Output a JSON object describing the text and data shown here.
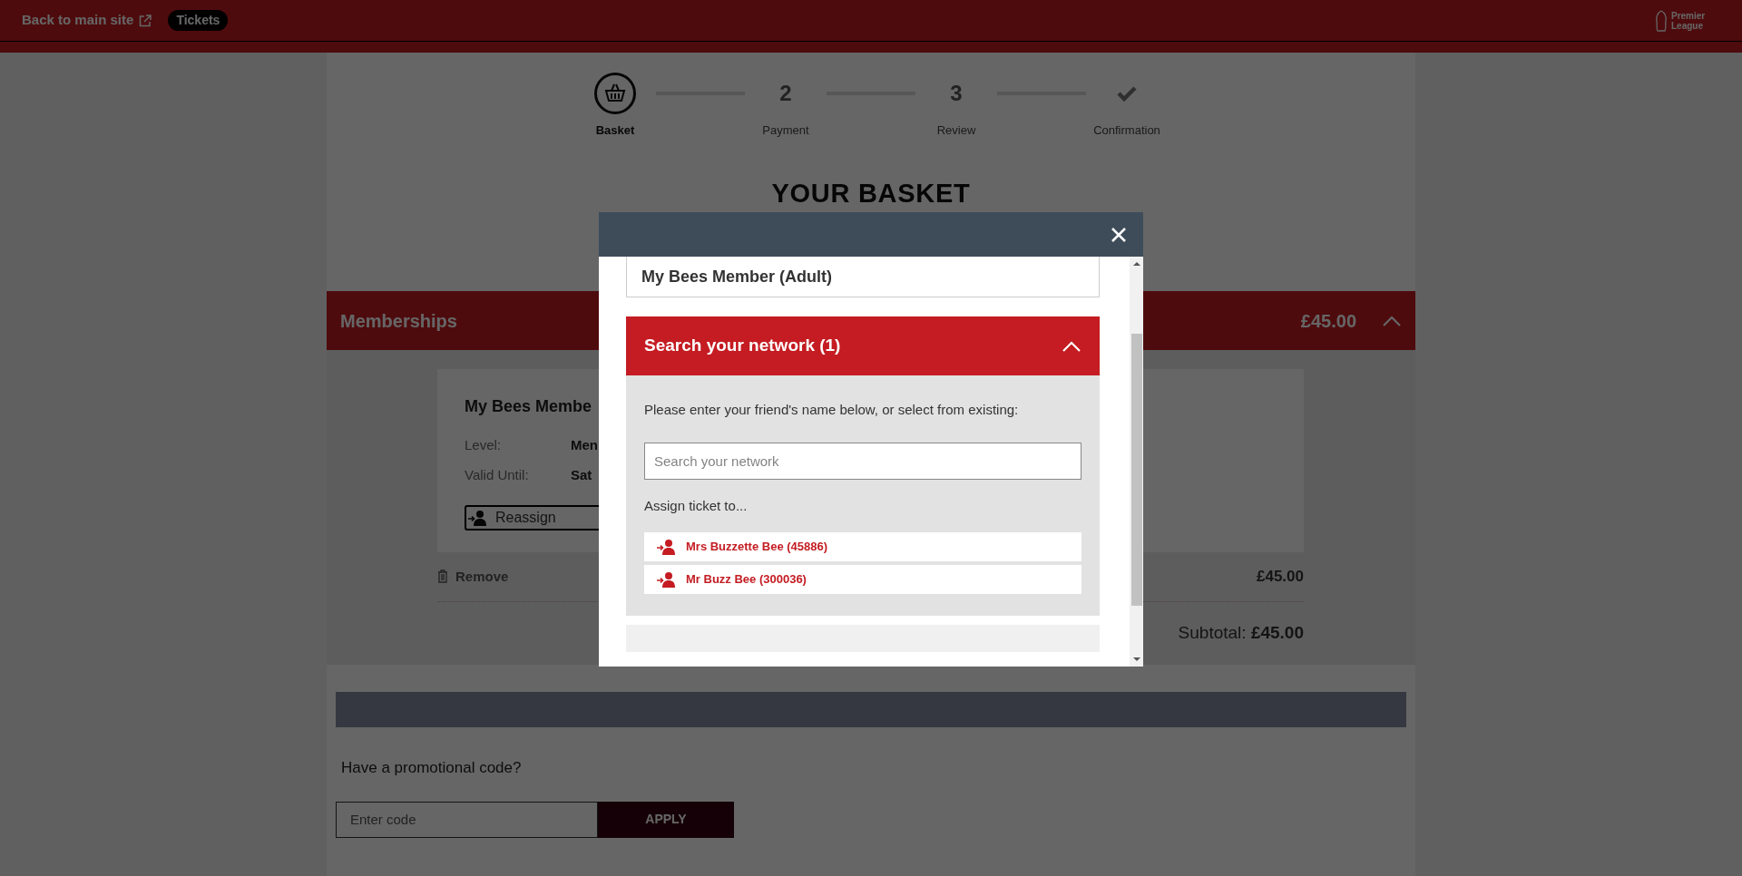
{
  "top_bar": {
    "back_link": "Back to main site",
    "tag": "Tickets",
    "logo_text": "Premier League"
  },
  "steps": [
    {
      "kind": "basket",
      "label": "Basket",
      "selected": true
    },
    {
      "kind": "number",
      "number": "2",
      "label": "Payment",
      "selected": false
    },
    {
      "kind": "number",
      "number": "3",
      "label": "Review",
      "selected": false
    },
    {
      "kind": "check",
      "label": "Confirmation",
      "selected": false
    }
  ],
  "page_title": "YOUR BASKET",
  "section": {
    "title": "Memberships",
    "total": "£45.00",
    "expanded": true
  },
  "item": {
    "name": "My Bees Membe",
    "fields": [
      {
        "label": "Level:",
        "value": "Men"
      },
      {
        "label": "Valid Until:",
        "value": "Sat"
      }
    ],
    "reassign": "Reassign",
    "remove": "Remove",
    "price": "£45.00"
  },
  "subtotal": "Subtotal: **£45.00**",
  "promo": {
    "prompt": "Have a promotional code?",
    "placeholder": "Enter code",
    "button": "APPLY"
  },
  "modal": {
    "product": "My Bees Member (Adult)",
    "panel": {
      "title": "Search your network (1)",
      "expanded": true,
      "instructions": "Please enter your friend's name below, or select from existing:",
      "search_placeholder": "Search your network",
      "assign_label": "Assign ticket to...",
      "people": [
        {
          "name": "Mrs Buzzette Bee",
          "id": "(45886)"
        },
        {
          "name": "Mr Buzz Bee",
          "id": "(300036)"
        }
      ]
    }
  }
}
